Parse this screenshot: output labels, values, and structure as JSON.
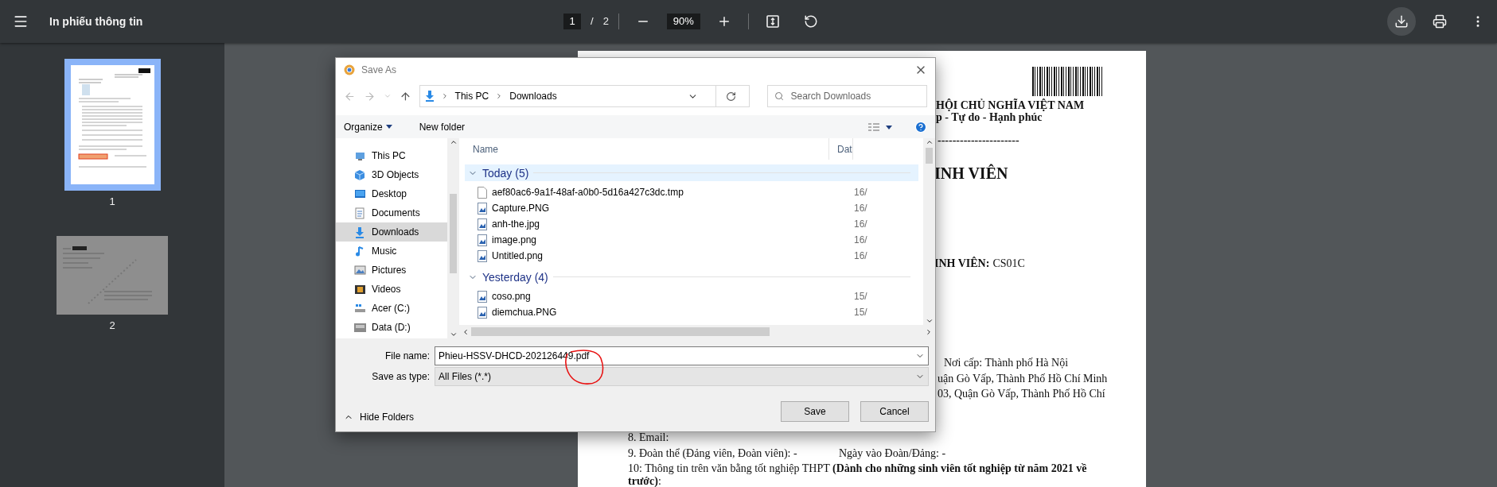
{
  "toolbar": {
    "title": "In phiếu thông tin",
    "page_current": "1",
    "page_separator": "/",
    "page_total": "2",
    "zoom": "90%"
  },
  "sidebar": {
    "thumbnails": [
      {
        "label": "1",
        "selected": true
      },
      {
        "label": "2",
        "selected": false
      }
    ]
  },
  "document": {
    "header_lines": [
      "HỘI CHỦ NGHĨA VIỆT NAM",
      "p - Tự do - Hạnh phúc"
    ],
    "rule": "----------------------",
    "heading": "INH VIÊN",
    "code_label": "INH VIÊN:",
    "code_value": "CS01C",
    "lines_right": [
      "Nơi cấp: Thành phố Hà Nội",
      "uận Gò Vấp, Thành Phố Hồ Chí Minh",
      "03, Quận Gò Vấp, Thành Phố Hồ Chí"
    ],
    "line_email": "8. Email:",
    "line_union": "9. Đoàn thể (Đảng viên, Đoàn viên): -",
    "line_union_date": "Ngày vào Đoàn/Đảng: -",
    "line_diploma": "10: Thông tin trên văn bằng tốt nghiệp THPT **(Dành cho những sinh viên tốt nghiệp từ năm 2021 về trước)**:"
  },
  "dialog": {
    "title": "Save As",
    "breadcrumb": [
      "This PC",
      "Downloads"
    ],
    "search_placeholder": "Search Downloads",
    "commands": [
      "Organize",
      "New folder"
    ],
    "nav_items": [
      {
        "label": "This PC",
        "kind": "pc",
        "selected": false
      },
      {
        "label": "3D Objects",
        "kind": "cube",
        "selected": false
      },
      {
        "label": "Desktop",
        "kind": "desktop",
        "selected": false
      },
      {
        "label": "Documents",
        "kind": "documents",
        "selected": false
      },
      {
        "label": "Downloads",
        "kind": "downloads",
        "selected": true
      },
      {
        "label": "Music",
        "kind": "music",
        "selected": false
      },
      {
        "label": "Pictures",
        "kind": "pictures",
        "selected": false
      },
      {
        "label": "Videos",
        "kind": "videos",
        "selected": false
      },
      {
        "label": "Acer (C:)",
        "kind": "system-drive",
        "selected": false
      },
      {
        "label": "Data (D:)",
        "kind": "drive",
        "selected": false
      }
    ],
    "columns": [
      "Name",
      "Dat"
    ],
    "groups": [
      {
        "label": "Today (5)",
        "expanded": true,
        "selected": true,
        "files": [
          {
            "name": "aef80ac6-9a1f-48af-a0b0-5d16a427c3dc.tmp",
            "kind": "file",
            "date": "16/"
          },
          {
            "name": "Capture.PNG",
            "kind": "image",
            "date": "16/"
          },
          {
            "name": "anh-the.jpg",
            "kind": "image",
            "date": "16/"
          },
          {
            "name": "image.png",
            "kind": "image",
            "date": "16/"
          },
          {
            "name": "Untitled.png",
            "kind": "image",
            "date": "16/"
          }
        ]
      },
      {
        "label": "Yesterday (4)",
        "expanded": true,
        "selected": false,
        "files": [
          {
            "name": "coso.png",
            "kind": "image",
            "date": "15/"
          },
          {
            "name": "diemchua.PNG",
            "kind": "image",
            "date": "15/"
          }
        ]
      }
    ],
    "file_name_label": "File name:",
    "file_name": "Phieu-HSSV-DHCD-202126449.pdf",
    "type_label": "Save as type:",
    "type_value": "All Files (*.*)",
    "hide_folders": "Hide Folders",
    "buttons": [
      "Save",
      "Cancel"
    ]
  }
}
